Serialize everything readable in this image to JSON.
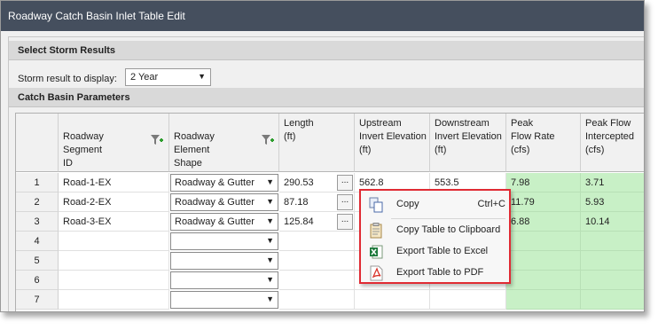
{
  "window": {
    "title": "Roadway Catch Basin Inlet Table Edit"
  },
  "storm": {
    "section_title": "Select Storm Results",
    "label": "Storm result to display:",
    "selected": "2 Year"
  },
  "params": {
    "section_title": "Catch Basin Parameters"
  },
  "columns": [
    "Roadway\nSegment\nID",
    "Roadway\nElement\nShape",
    "Length\n(ft)",
    "Upstream\nInvert Elevation\n(ft)",
    "Downstream\nInvert Elevation\n(ft)",
    "Peak\nFlow Rate\n(cfs)",
    "Peak Flow\nIntercepted\n(cfs)"
  ],
  "rows": [
    {
      "num": "1",
      "segment": "Road-1-EX",
      "shape": "Roadway & Gutter",
      "length": "290.53",
      "up": "562.8",
      "down": "553.5",
      "peak": "7.98",
      "intercepted": "3.71"
    },
    {
      "num": "2",
      "segment": "Road-2-EX",
      "shape": "Roadway & Gutter",
      "length": "87.18",
      "up": "",
      "down": "",
      "peak": "11.79",
      "intercepted": "5.93"
    },
    {
      "num": "3",
      "segment": "Road-3-EX",
      "shape": "Roadway & Gutter",
      "length": "125.84",
      "up": "",
      "down": "",
      "peak": "6.88",
      "intercepted": "10.14"
    },
    {
      "num": "4",
      "segment": "",
      "shape": "",
      "length": "",
      "up": "",
      "down": "",
      "peak": "",
      "intercepted": ""
    },
    {
      "num": "5",
      "segment": "",
      "shape": "",
      "length": "",
      "up": "",
      "down": "",
      "peak": "",
      "intercepted": ""
    },
    {
      "num": "6",
      "segment": "",
      "shape": "",
      "length": "",
      "up": "",
      "down": "",
      "peak": "",
      "intercepted": ""
    },
    {
      "num": "7",
      "segment": "",
      "shape": "",
      "length": "",
      "up": "",
      "down": "",
      "peak": "",
      "intercepted": ""
    }
  ],
  "context_menu": {
    "copy": "Copy",
    "copy_shortcut": "Ctrl+C",
    "copy_clipboard": "Copy Table to Clipboard",
    "export_excel": "Export Table to Excel",
    "export_pdf": "Export Table to PDF",
    "icons": [
      "copy-icon",
      "clipboard-icon",
      "excel-icon",
      "pdf-icon"
    ]
  },
  "colors": {
    "titlebar": "#454f5e",
    "result_cells": "#c8f0c6",
    "menu_border": "#e02a33"
  }
}
